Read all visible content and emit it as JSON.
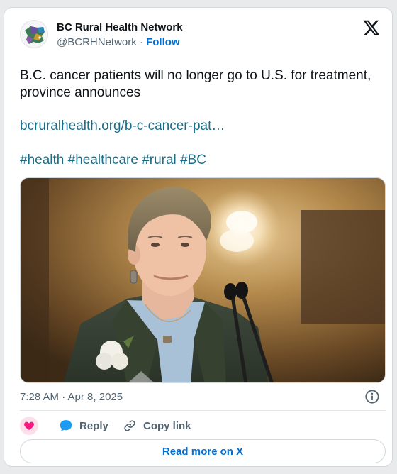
{
  "author": {
    "name": "BC Rural Health Network",
    "handle": "@BCRHNetwork",
    "separator": " · ",
    "follow_label": "Follow"
  },
  "tweet": {
    "text": "B.C. cancer patients will no longer go to U.S. for treatment, province announces",
    "link_text": "bcruralhealth.org/b-c-cancer-pat…",
    "hashtags": [
      "#health",
      "#healthcare",
      "#rural",
      "#BC"
    ]
  },
  "meta": {
    "timestamp": "7:28 AM · Apr 8, 2025"
  },
  "actions": {
    "reply_label": "Reply",
    "copy_link_label": "Copy link",
    "read_more_label": "Read more on X"
  },
  "colors": {
    "link": "#1b6e87",
    "follow": "#006fd6",
    "heart": "#f91880",
    "reply_bubble": "#1d9bf0",
    "muted": "#536471"
  },
  "icons": {
    "brand": "x-logo-icon",
    "info": "info-icon",
    "like": "heart-icon",
    "reply": "reply-bubble-icon",
    "copy": "link-icon"
  }
}
